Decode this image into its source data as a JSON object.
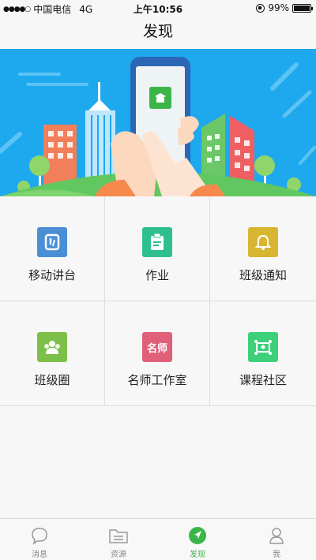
{
  "status_bar": {
    "signal": "●●●●○",
    "carrier": "中国电信",
    "network": "4G",
    "time": "上午10:56",
    "battery_percent": "99%",
    "battery_level": 0.99
  },
  "nav": {
    "title": "发现"
  },
  "features": [
    {
      "label": "移动讲台",
      "color": "#4a8ed6",
      "icon": "mobile-lectern-icon"
    },
    {
      "label": "作业",
      "color": "#2fbf8f",
      "icon": "homework-icon"
    },
    {
      "label": "班级通知",
      "color": "#d9b632",
      "icon": "bell-icon"
    },
    {
      "label": "班级圈",
      "color": "#7cbf4a",
      "icon": "class-circle-icon"
    },
    {
      "label": "名师工作室",
      "color": "#e0607a",
      "icon": "famous-teacher-icon",
      "icon_text": "名师"
    },
    {
      "label": "课程社区",
      "color": "#3ecf7a",
      "icon": "course-community-icon"
    }
  ],
  "tabs": [
    {
      "label": "消息",
      "icon": "message-icon",
      "active": false
    },
    {
      "label": "资源",
      "icon": "folder-icon",
      "active": false
    },
    {
      "label": "发现",
      "icon": "discover-icon",
      "active": true
    },
    {
      "label": "我",
      "icon": "profile-icon",
      "active": false
    }
  ],
  "colors": {
    "accent": "#3bb54a",
    "banner_sky": "#1ea8ee"
  }
}
